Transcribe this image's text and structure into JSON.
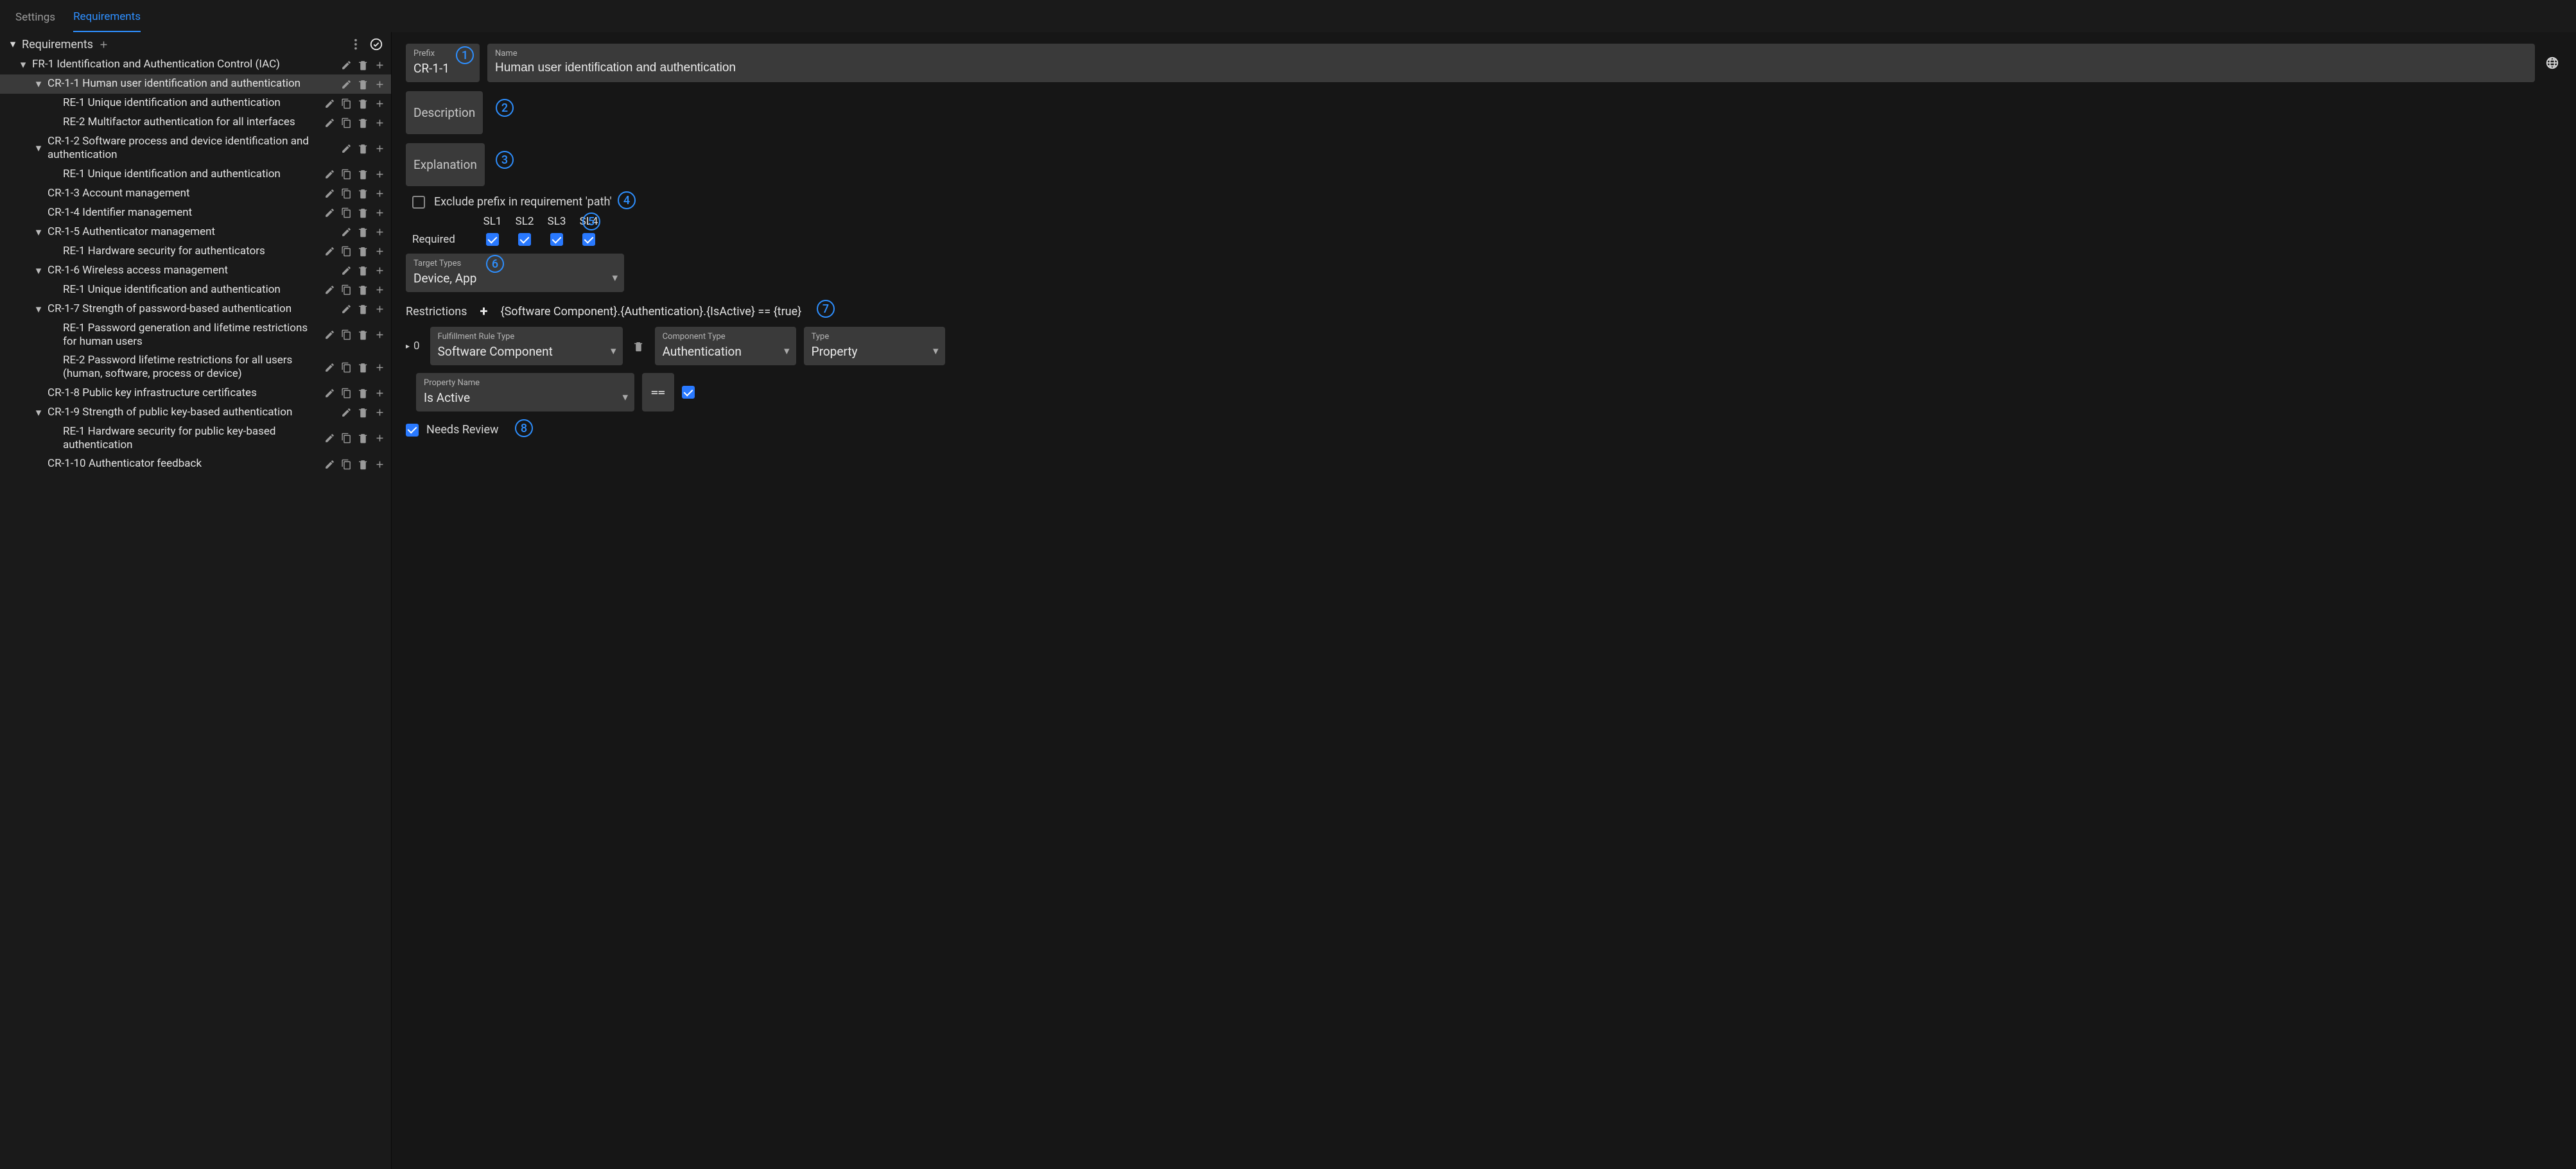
{
  "tabs": {
    "settings": "Settings",
    "requirements": "Requirements",
    "active": "requirements"
  },
  "sidebar": {
    "root_label": "Requirements",
    "items": [
      {
        "id": "fr1",
        "depth": 1,
        "caret": "▾",
        "label": "FR-1 Identification and Authentication Control (IAC)",
        "actions": [
          "edit",
          "delete",
          "add"
        ]
      },
      {
        "id": "cr11",
        "depth": 2,
        "caret": "▾",
        "selected": true,
        "label": "CR-1-1 Human user identification and authentication",
        "actions": [
          "edit",
          "delete",
          "add"
        ]
      },
      {
        "id": "re1a",
        "depth": 3,
        "caret": "",
        "label": "RE-1 Unique identification and authentication",
        "actions": [
          "edit",
          "copy",
          "delete",
          "add"
        ]
      },
      {
        "id": "re2a",
        "depth": 3,
        "caret": "",
        "label": "RE-2 Multifactor authentication for all interfaces",
        "actions": [
          "edit",
          "copy",
          "delete",
          "add"
        ]
      },
      {
        "id": "cr12",
        "depth": 2,
        "caret": "▾",
        "label": "CR-1-2 Software process and device identification and authentication",
        "actions_offset": true,
        "actions": [
          "edit",
          "delete",
          "add"
        ]
      },
      {
        "id": "re1b",
        "depth": 3,
        "caret": "",
        "label": "RE-1 Unique identification and authentication",
        "actions": [
          "edit",
          "copy",
          "delete",
          "add"
        ]
      },
      {
        "id": "cr13",
        "depth": 2,
        "caret": "",
        "label": "CR-1-3 Account management",
        "actions": [
          "edit",
          "copy",
          "delete",
          "add"
        ]
      },
      {
        "id": "cr14",
        "depth": 2,
        "caret": "",
        "label": "CR-1-4 Identifier management",
        "actions": [
          "edit",
          "copy",
          "delete",
          "add"
        ]
      },
      {
        "id": "cr15",
        "depth": 2,
        "caret": "▾",
        "label": "CR-1-5 Authenticator management",
        "actions": [
          "edit",
          "delete",
          "add"
        ]
      },
      {
        "id": "re1c",
        "depth": 3,
        "caret": "",
        "label": "RE-1 Hardware security for authenticators",
        "actions": [
          "edit",
          "copy",
          "delete",
          "add"
        ]
      },
      {
        "id": "cr16",
        "depth": 2,
        "caret": "▾",
        "label": "CR-1-6 Wireless access management",
        "actions": [
          "edit",
          "delete",
          "add"
        ]
      },
      {
        "id": "re1d",
        "depth": 3,
        "caret": "",
        "label": "RE-1 Unique identification and authentication",
        "actions": [
          "edit",
          "copy",
          "delete",
          "add"
        ]
      },
      {
        "id": "cr17",
        "depth": 2,
        "caret": "▾",
        "label": "CR-1-7 Strength of password-based authentication",
        "actions": [
          "edit",
          "delete",
          "add"
        ]
      },
      {
        "id": "re1e",
        "depth": 3,
        "caret": "",
        "label": "RE-1 Password generation and lifetime restrictions for human users",
        "actions": [
          "edit",
          "copy",
          "delete",
          "add"
        ]
      },
      {
        "id": "re2b",
        "depth": 3,
        "caret": "",
        "label": "RE-2 Password lifetime restrictions for all users (human, software, process or device)",
        "actions": [
          "edit",
          "copy",
          "delete",
          "add"
        ]
      },
      {
        "id": "cr18",
        "depth": 2,
        "caret": "",
        "label": "CR-1-8 Public key infrastructure certificates",
        "actions": [
          "edit",
          "copy",
          "delete",
          "add"
        ]
      },
      {
        "id": "cr19",
        "depth": 2,
        "caret": "▾",
        "label": "CR-1-9 Strength of public key-based authentication",
        "actions": [
          "edit",
          "delete",
          "add"
        ]
      },
      {
        "id": "re1f",
        "depth": 3,
        "caret": "",
        "label": "RE-1 Hardware security for public key-based authentication",
        "actions": [
          "edit",
          "copy",
          "delete",
          "add"
        ]
      },
      {
        "id": "cr110",
        "depth": 2,
        "caret": "",
        "label": "CR-1-10 Authenticator feedback",
        "actions": [
          "edit",
          "copy",
          "delete",
          "add"
        ]
      }
    ]
  },
  "detail": {
    "prefix_label": "Prefix",
    "prefix_value": "CR-1-1",
    "name_label": "Name",
    "name_value": "Human user identification and authentication",
    "description_label": "Description",
    "explanation_label": "Explanation",
    "exclude_prefix_label": "Exclude prefix in requirement 'path'",
    "exclude_prefix_checked": false,
    "sl_headers": [
      "SL1",
      "SL2",
      "SL3",
      "SL4"
    ],
    "required_label": "Required",
    "required": [
      true,
      true,
      true,
      true
    ],
    "target_types_label": "Target Types",
    "target_types_value": "Device, App",
    "restrictions_label": "Restrictions",
    "restriction_expr": "{Software Component}.{Authentication}.{IsActive} == {true}",
    "rule": {
      "index": "0",
      "fulfillment_label": "Fulfillment Rule Type",
      "fulfillment_value": "Software Component",
      "component_type_label": "Component Type",
      "component_type_value": "Authentication",
      "type_label": "Type",
      "type_value": "Property",
      "property_label": "Property Name",
      "property_value": "Is Active",
      "operator": "==",
      "bool_checked": true
    },
    "needs_review_label": "Needs Review",
    "needs_review_checked": true
  },
  "badges": [
    "1",
    "2",
    "3",
    "4",
    "5",
    "6",
    "7",
    "8"
  ]
}
